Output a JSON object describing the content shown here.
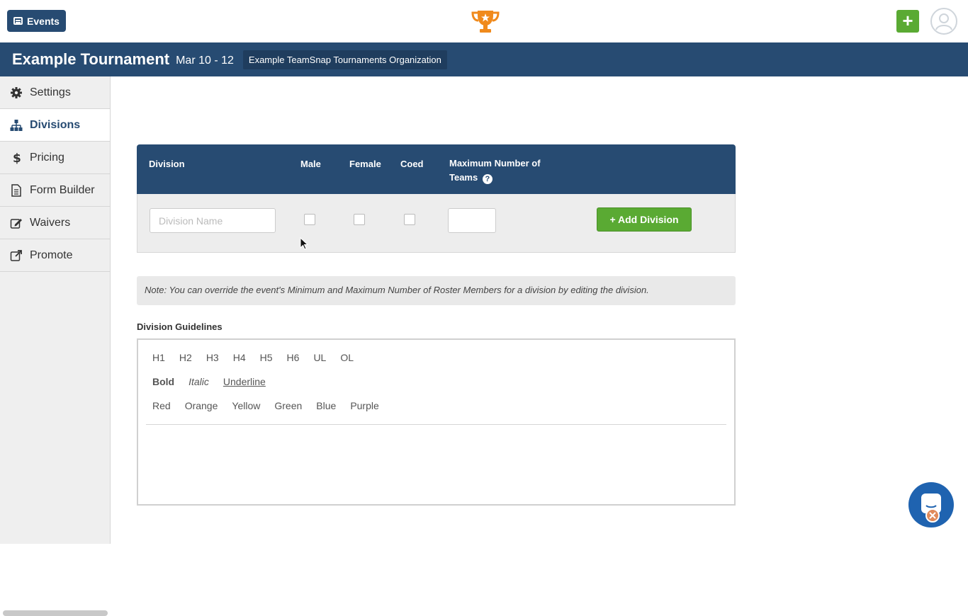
{
  "topbar": {
    "events_label": "Events",
    "events_icon": "events-list-icon",
    "logo_icon": "trophy-icon",
    "add_button_label": "+",
    "avatar_icon": "user-avatar-icon",
    "colors": {
      "brand": "#274b72",
      "accent_green": "#5aaa33",
      "trophy_orange": "#f08a1c"
    }
  },
  "header": {
    "title": "Example Tournament",
    "dates": "Mar 10 - 12",
    "organization": "Example TeamSnap Tournaments Organization"
  },
  "sidebar": {
    "items": [
      {
        "label": "Settings",
        "icon": "gear-icon",
        "active": false
      },
      {
        "label": "Divisions",
        "icon": "sitemap-icon",
        "active": true
      },
      {
        "label": "Pricing",
        "icon": "dollar-icon",
        "active": false
      },
      {
        "label": "Form Builder",
        "icon": "document-icon",
        "active": false
      },
      {
        "label": "Waivers",
        "icon": "edit-icon",
        "active": false
      },
      {
        "label": "Promote",
        "icon": "external-link-icon",
        "active": false
      }
    ]
  },
  "divisions_table": {
    "headers": {
      "division": "Division",
      "male": "Male",
      "female": "Female",
      "coed": "Coed",
      "max_teams_line1": "Maximum Number of",
      "max_teams_line2": "Teams"
    },
    "help_icon": "question-circle-icon",
    "row": {
      "division_name_placeholder": "Division Name",
      "division_name_value": "",
      "male_checked": false,
      "female_checked": false,
      "coed_checked": false,
      "max_teams_value": "",
      "add_button_label": "+ Add Division"
    }
  },
  "note": "Note: You can override the event's Minimum and Maximum Number of Roster Members for a division by editing the division.",
  "guidelines": {
    "label": "Division Guidelines",
    "toolbar": {
      "headings": [
        "H1",
        "H2",
        "H3",
        "H4",
        "H5",
        "H6",
        "UL",
        "OL"
      ],
      "formats": {
        "bold": "Bold",
        "italic": "Italic",
        "underline": "Underline"
      },
      "colors": [
        "Red",
        "Orange",
        "Yellow",
        "Green",
        "Blue",
        "Purple"
      ]
    },
    "content": ""
  },
  "chat_widget_icon": "chat-icon"
}
